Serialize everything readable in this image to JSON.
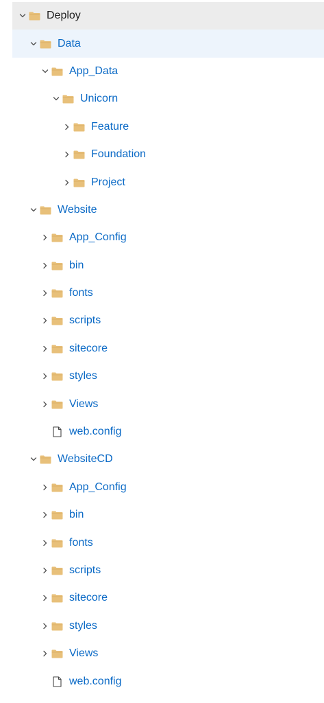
{
  "colors": {
    "link": "#0b6ac6",
    "folder": "#e8c07a",
    "hover_row": "#ececec",
    "selected_row": "#edf4fc"
  },
  "tree": [
    {
      "label": "Deploy",
      "type": "folder",
      "level": 0,
      "state": "expanded",
      "style": "dark",
      "row": "hover"
    },
    {
      "label": "Data",
      "type": "folder",
      "level": 1,
      "state": "expanded",
      "style": "link",
      "row": "selected"
    },
    {
      "label": "App_Data",
      "type": "folder",
      "level": 2,
      "state": "expanded",
      "style": "link",
      "row": ""
    },
    {
      "label": "Unicorn",
      "type": "folder",
      "level": 3,
      "state": "expanded",
      "style": "link",
      "row": ""
    },
    {
      "label": "Feature",
      "type": "folder",
      "level": 4,
      "state": "collapsed",
      "style": "link",
      "row": ""
    },
    {
      "label": "Foundation",
      "type": "folder",
      "level": 4,
      "state": "collapsed",
      "style": "link",
      "row": ""
    },
    {
      "label": "Project",
      "type": "folder",
      "level": 4,
      "state": "collapsed",
      "style": "link",
      "row": ""
    },
    {
      "label": "Website",
      "type": "folder",
      "level": 1,
      "state": "expanded",
      "style": "link",
      "row": ""
    },
    {
      "label": "App_Config",
      "type": "folder",
      "level": 2,
      "state": "collapsed",
      "style": "link",
      "row": ""
    },
    {
      "label": "bin",
      "type": "folder",
      "level": 2,
      "state": "collapsed",
      "style": "link",
      "row": ""
    },
    {
      "label": "fonts",
      "type": "folder",
      "level": 2,
      "state": "collapsed",
      "style": "link",
      "row": ""
    },
    {
      "label": "scripts",
      "type": "folder",
      "level": 2,
      "state": "collapsed",
      "style": "link",
      "row": ""
    },
    {
      "label": "sitecore",
      "type": "folder",
      "level": 2,
      "state": "collapsed",
      "style": "link",
      "row": ""
    },
    {
      "label": "styles",
      "type": "folder",
      "level": 2,
      "state": "collapsed",
      "style": "link",
      "row": ""
    },
    {
      "label": "Views",
      "type": "folder",
      "level": 2,
      "state": "collapsed",
      "style": "link",
      "row": ""
    },
    {
      "label": "web.config",
      "type": "file",
      "level": 2,
      "state": "none",
      "style": "link",
      "row": ""
    },
    {
      "label": "WebsiteCD",
      "type": "folder",
      "level": 1,
      "state": "expanded",
      "style": "link",
      "row": ""
    },
    {
      "label": "App_Config",
      "type": "folder",
      "level": 2,
      "state": "collapsed",
      "style": "link",
      "row": ""
    },
    {
      "label": "bin",
      "type": "folder",
      "level": 2,
      "state": "collapsed",
      "style": "link",
      "row": ""
    },
    {
      "label": "fonts",
      "type": "folder",
      "level": 2,
      "state": "collapsed",
      "style": "link",
      "row": ""
    },
    {
      "label": "scripts",
      "type": "folder",
      "level": 2,
      "state": "collapsed",
      "style": "link",
      "row": ""
    },
    {
      "label": "sitecore",
      "type": "folder",
      "level": 2,
      "state": "collapsed",
      "style": "link",
      "row": ""
    },
    {
      "label": "styles",
      "type": "folder",
      "level": 2,
      "state": "collapsed",
      "style": "link",
      "row": ""
    },
    {
      "label": "Views",
      "type": "folder",
      "level": 2,
      "state": "collapsed",
      "style": "link",
      "row": ""
    },
    {
      "label": "web.config",
      "type": "file",
      "level": 2,
      "state": "none",
      "style": "link",
      "row": ""
    }
  ]
}
